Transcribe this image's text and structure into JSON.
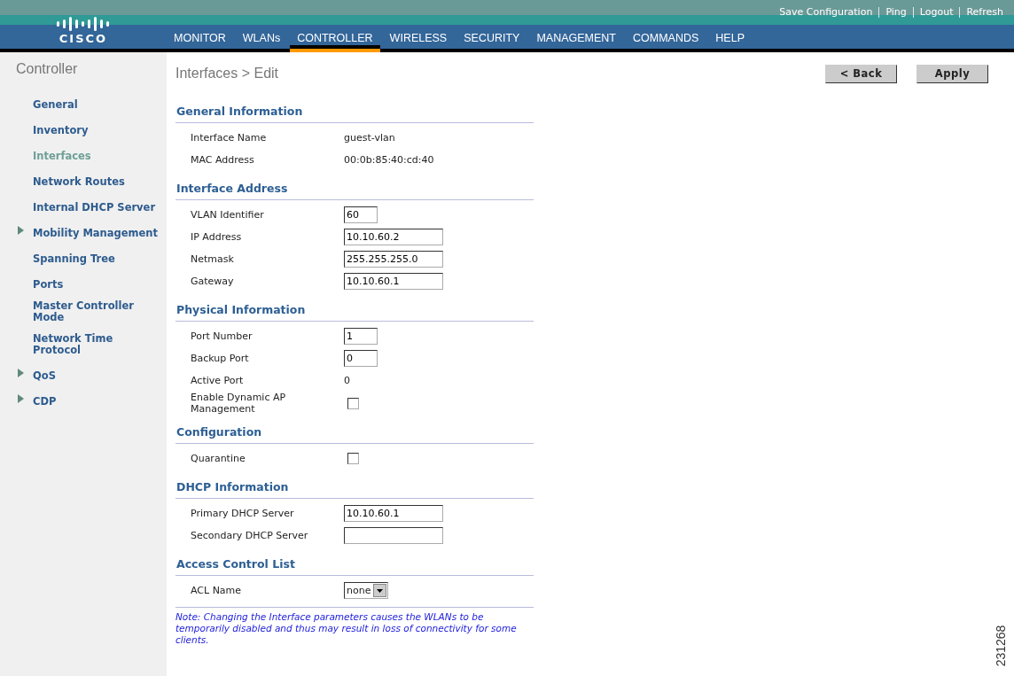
{
  "header": {
    "logo_text": "CISCO",
    "links": [
      "Save Configuration",
      "Ping",
      "Logout",
      "Refresh"
    ],
    "nav": [
      {
        "label": "MONITOR",
        "selected": false
      },
      {
        "label": "WLANs",
        "selected": false
      },
      {
        "label": "CONTROLLER",
        "selected": true
      },
      {
        "label": "WIRELESS",
        "selected": false
      },
      {
        "label": "SECURITY",
        "selected": false
      },
      {
        "label": "MANAGEMENT",
        "selected": false
      },
      {
        "label": "COMMANDS",
        "selected": false
      },
      {
        "label": "HELP",
        "selected": false
      }
    ]
  },
  "sidebar": {
    "title": "Controller",
    "items": [
      {
        "label": "General",
        "selected": false,
        "expandable": false
      },
      {
        "label": "Inventory",
        "selected": false,
        "expandable": false
      },
      {
        "label": "Interfaces",
        "selected": true,
        "expandable": false
      },
      {
        "label": "Network Routes",
        "selected": false,
        "expandable": false
      },
      {
        "label": "Internal DHCP Server",
        "selected": false,
        "expandable": false
      },
      {
        "label": "Mobility Management",
        "selected": false,
        "expandable": true
      },
      {
        "label": "Spanning Tree",
        "selected": false,
        "expandable": false
      },
      {
        "label": "Ports",
        "selected": false,
        "expandable": false
      },
      {
        "label": "Master Controller Mode",
        "selected": false,
        "expandable": false
      },
      {
        "label": "Network Time Protocol",
        "selected": false,
        "expandable": false
      },
      {
        "label": "QoS",
        "selected": false,
        "expandable": true
      },
      {
        "label": "CDP",
        "selected": false,
        "expandable": true
      }
    ]
  },
  "page": {
    "breadcrumb": "Interfaces > Edit",
    "buttons": [
      "< Back",
      "Apply"
    ]
  },
  "sections": [
    {
      "title": "General Information",
      "rows": [
        {
          "kind": "text",
          "label": "Interface Name",
          "value": "guest-vlan"
        },
        {
          "kind": "text",
          "label": "MAC Address",
          "value": "00:0b:85:40:cd:40"
        }
      ]
    },
    {
      "title": "Interface Address",
      "rows": [
        {
          "kind": "short_input",
          "label": "VLAN Identifier",
          "value": "60"
        },
        {
          "kind": "input",
          "label": "IP Address",
          "value": "10.10.60.2"
        },
        {
          "kind": "input",
          "label": "Netmask",
          "value": "255.255.255.0"
        },
        {
          "kind": "input",
          "label": "Gateway",
          "value": "10.10.60.1"
        }
      ]
    },
    {
      "title": "Physical Information",
      "rows": [
        {
          "kind": "short_input",
          "label": "Port Number",
          "value": "1"
        },
        {
          "kind": "short_input",
          "label": "Backup Port",
          "value": "0"
        },
        {
          "kind": "text",
          "label": "Active Port",
          "value": "0"
        },
        {
          "kind": "checkbox",
          "label": "Enable Dynamic AP Management",
          "checked": false
        }
      ]
    },
    {
      "title": "Configuration",
      "rows": [
        {
          "kind": "checkbox",
          "label": "Quarantine",
          "checked": false
        }
      ]
    },
    {
      "title": "DHCP Information",
      "rows": [
        {
          "kind": "input",
          "label": "Primary DHCP Server",
          "value": "10.10.60.1"
        },
        {
          "kind": "input",
          "label": "Secondary DHCP Server"
        }
      ]
    },
    {
      "title": "Access Control List",
      "rows": [
        {
          "kind": "select",
          "label": "ACL Name",
          "value": "none"
        }
      ]
    }
  ],
  "note": "Note: Changing the Interface parameters causes the WLANs to be temporarily disabled and thus may result in loss of connectivity for some clients.",
  "figure_id": "231268"
}
